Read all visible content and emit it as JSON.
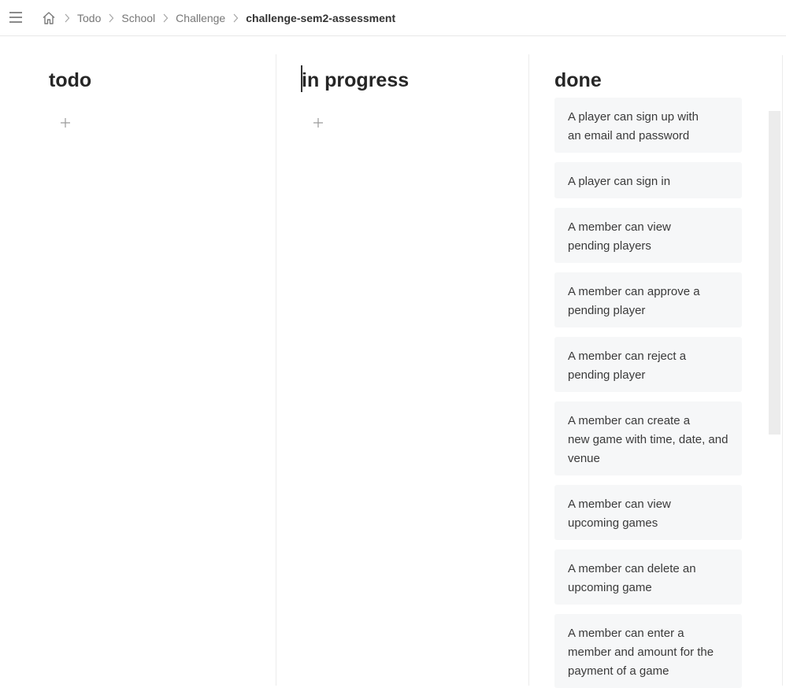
{
  "breadcrumb": {
    "items": [
      "Todo",
      "School",
      "Challenge"
    ],
    "current": "challenge-sem2-assessment"
  },
  "columns": {
    "todo": {
      "title": "todo"
    },
    "in_progress": {
      "title": "in progress"
    },
    "done": {
      "title": "done",
      "cards": [
        {
          "line1": "A player can sign up with",
          "line2": "an email and password"
        },
        {
          "line1": "A player can sign in"
        },
        {
          "line1": "A member can view",
          "line2": "pending players"
        },
        {
          "line1": "A member can approve a",
          "line2": "pending player"
        },
        {
          "line1": "A member can reject a",
          "line2": "pending player"
        },
        {
          "line1": "A member can create a",
          "line2": "new game with time, date, and",
          "line3": "venue"
        },
        {
          "line1": "A member can view",
          "line2": "upcoming games"
        },
        {
          "line1": "A member can delete an",
          "line2": "upcoming game"
        },
        {
          "line1": "A member can enter a",
          "line2": "member and amount for the",
          "line3": "payment of a game"
        }
      ]
    }
  },
  "icons": {
    "menu": "hamburger-menu-icon",
    "home": "home-icon",
    "separator": "chevron-right-icon",
    "add": "plus-icon"
  }
}
